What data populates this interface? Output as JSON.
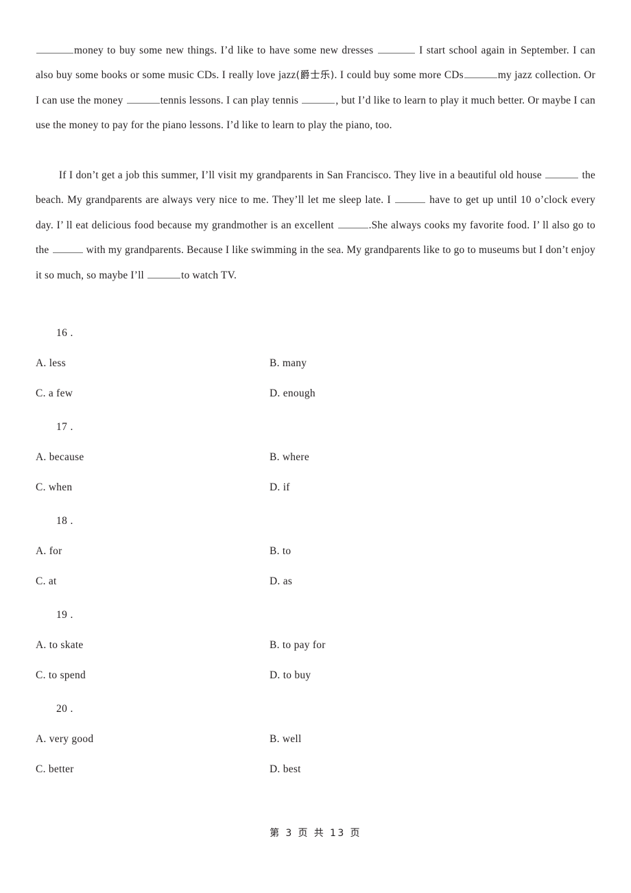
{
  "document": {
    "type": "english-exam-cloze-worksheet",
    "page_background": "#ffffff",
    "text_color": "#231f20",
    "blank_rule_color": "#6f6f6f"
  },
  "passage": {
    "paragraph1": {
      "seg1": "money to buy some new things. I’d like to have some new dresses",
      "seg2": "I start school again in September. I can also buy some books or some music CDs. I really love jazz",
      "annotation_cn": "(爵士乐)",
      "seg3": ". I could buy some more CDs",
      "seg4": "my jazz collection. Or I can use the money",
      "seg5": "tennis lessons. I can play tennis",
      "seg6": ", but I’d like to learn to play it much better. Or maybe I can use the money to pay for the piano lessons. I’d like to learn to play the piano, too."
    },
    "paragraph2": {
      "seg1": "If I don’t get a job this summer, I’ll visit my grandparents in San Francisco. They live in a beautiful old house",
      "seg2": "the beach. My grandparents are always very nice to me. They’ll let me sleep late. I",
      "seg3": "have to get up until 10 o’clock every day. I’ ll eat delicious food because my grandmother is an excellent",
      "seg4": ".She always cooks my favorite food. I’ ll also go to the",
      "seg5": "with my grandparents. Because I like swimming in the sea. My grandparents like to go to museums but I don’t enjoy it so much, so maybe I’ll",
      "seg6": "to watch TV."
    }
  },
  "questions": [
    {
      "number": "16 .",
      "options": [
        {
          "label": "A. less"
        },
        {
          "label": "B. many"
        },
        {
          "label": "C. a few"
        },
        {
          "label": "D. enough"
        }
      ]
    },
    {
      "number": "17 .",
      "options": [
        {
          "label": "A. because"
        },
        {
          "label": "B. where"
        },
        {
          "label": "C. when"
        },
        {
          "label": "D. if"
        }
      ]
    },
    {
      "number": "18 .",
      "options": [
        {
          "label": "A. for"
        },
        {
          "label": "B. to"
        },
        {
          "label": "C. at"
        },
        {
          "label": "D. as"
        }
      ]
    },
    {
      "number": "19 .",
      "options": [
        {
          "label": "A. to skate"
        },
        {
          "label": "B. to pay for"
        },
        {
          "label": "C. to spend"
        },
        {
          "label": "D. to buy"
        }
      ]
    },
    {
      "number": "20 .",
      "options": [
        {
          "label": "A. very good"
        },
        {
          "label": "B. well"
        },
        {
          "label": "C. better"
        },
        {
          "label": "D. best"
        }
      ]
    }
  ],
  "footer": {
    "page_text": "第 3 页 共 13 页"
  }
}
